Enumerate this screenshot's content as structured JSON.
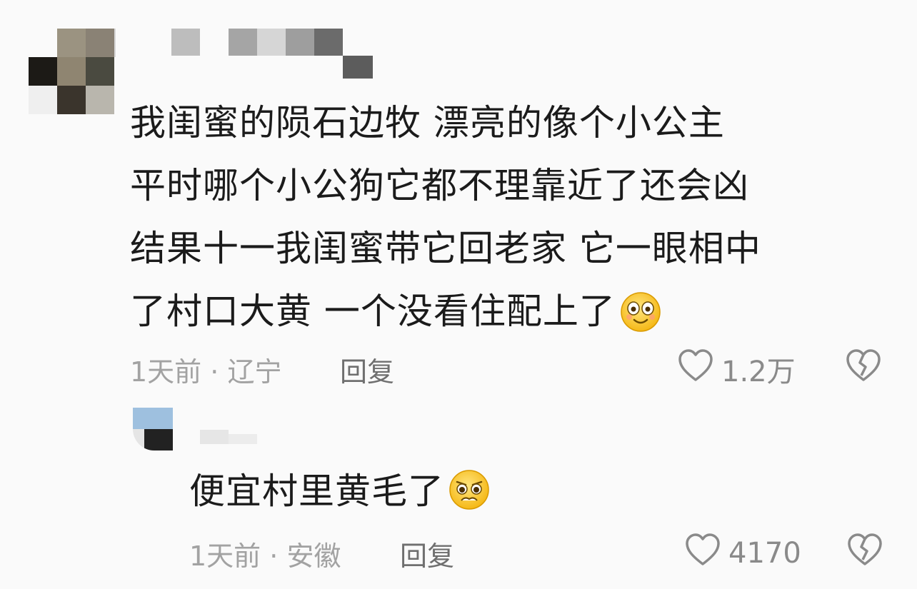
{
  "comments": [
    {
      "text_lines": [
        "我闺蜜的陨石边牧 漂亮的像个小公主",
        "平时哪个小公狗它都不理靠近了还会凶",
        "结果十一我闺蜜带它回老家 它一眼相中",
        "了村口大黄 一个没看住配上了"
      ],
      "emoji": "smile-emoji",
      "time": "1天前",
      "separator": "·",
      "location": "辽宁",
      "reply_label": "回复",
      "likes": "1.2万",
      "dislike_icon": "broken-heart-icon",
      "like_icon": "heart-icon"
    },
    {
      "text": "便宜村里黄毛了",
      "emoji": "pleading-emoji",
      "time": "1天前",
      "separator": "·",
      "location": "安徽",
      "reply_label": "回复",
      "likes": "4170",
      "dislike_icon": "broken-heart-icon",
      "like_icon": "heart-icon"
    }
  ],
  "colors": {
    "background": "#fafafa",
    "text": "#1b1b1b",
    "meta": "#a2a2a2",
    "reply": "#6f6f6f"
  }
}
